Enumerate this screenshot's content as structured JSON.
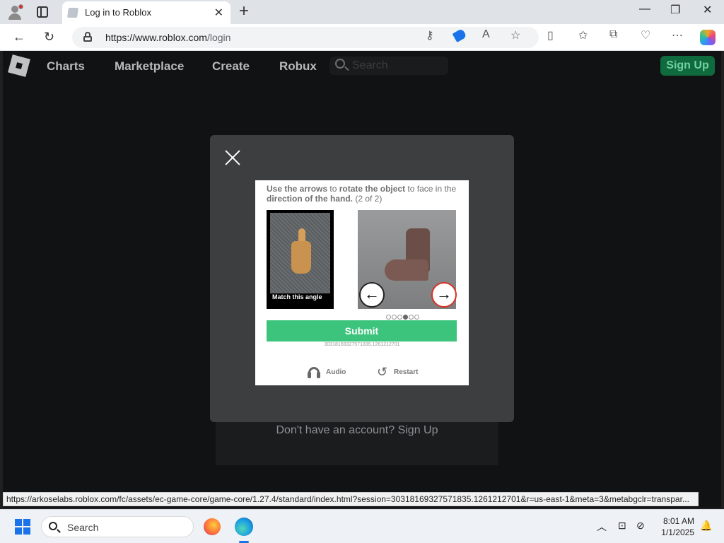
{
  "browser": {
    "tab_title": "Log in to Roblox",
    "url_host": "https://www.roblox.com",
    "url_path": "/login",
    "status_url": "https://arkoselabs.roblox.com/fc/assets/ec-game-core/game-core/1.27.4/standard/index.html?session=30318169327571835.1261212701&r=us-east-1&meta=3&metabgclr=transpar..."
  },
  "roblox": {
    "nav": [
      "Charts",
      "Marketplace",
      "Create",
      "Robux"
    ],
    "search_placeholder": "Search",
    "signup_label": "Sign Up",
    "no_account": "Don't have an account? Sign Up"
  },
  "captcha": {
    "instr_1": "Use the arrows",
    "instr_2": " to ",
    "instr_3": "rotate the object",
    "instr_4": " to face in the ",
    "instr_5": "direction of the hand.",
    "instr_6": " (2 of 2)",
    "match_label": "Match this angle",
    "submit_label": "Submit",
    "session_id": "30318169327571835.1261212701",
    "audio_label": "Audio",
    "restart_label": "Restart",
    "progress_current": 4,
    "progress_total": 6
  },
  "taskbar": {
    "search_label": "Search",
    "time": "8:01 AM",
    "date": "1/1/2025"
  },
  "colors": {
    "submit_green": "#3cc47c",
    "signup_green": "#0f6a3d",
    "page_bg": "#111214",
    "modal_bg": "#3d3e40"
  },
  "icons": [
    "profile-icon",
    "tab-actions-icon",
    "close-icon",
    "back-icon",
    "refresh-icon",
    "lock-icon",
    "key-icon",
    "tag-icon",
    "read-aloud-icon",
    "favorite-icon",
    "split-screen-icon",
    "favorites-icon",
    "collections-icon",
    "health-icon",
    "more-icon",
    "copilot-icon",
    "roblox-logo",
    "search-icon",
    "headphones-icon",
    "restart-icon",
    "windows-start-icon",
    "firefox-icon",
    "edge-icon",
    "chevron-up-icon",
    "network-icon",
    "bell-icon"
  ]
}
